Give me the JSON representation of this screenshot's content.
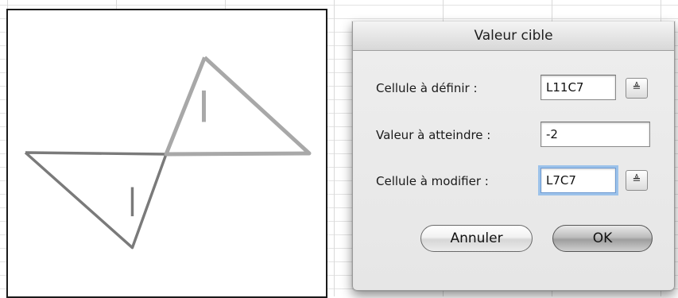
{
  "dialog": {
    "title": "Valeur cible",
    "fields": [
      {
        "label": "Cellule à définir :",
        "value": "L11C7"
      },
      {
        "label": "Valeur à atteindre :",
        "value": "-2"
      },
      {
        "label": "Cellule à modifier :",
        "value": "L7C7"
      }
    ],
    "ref_button_glyph": "≜",
    "cancel_label": "Annuler",
    "ok_label": "OK"
  },
  "chart": {
    "colors": {
      "dark_triangle": "#7a7a7a",
      "light_triangle": "#a8a8a8"
    }
  }
}
